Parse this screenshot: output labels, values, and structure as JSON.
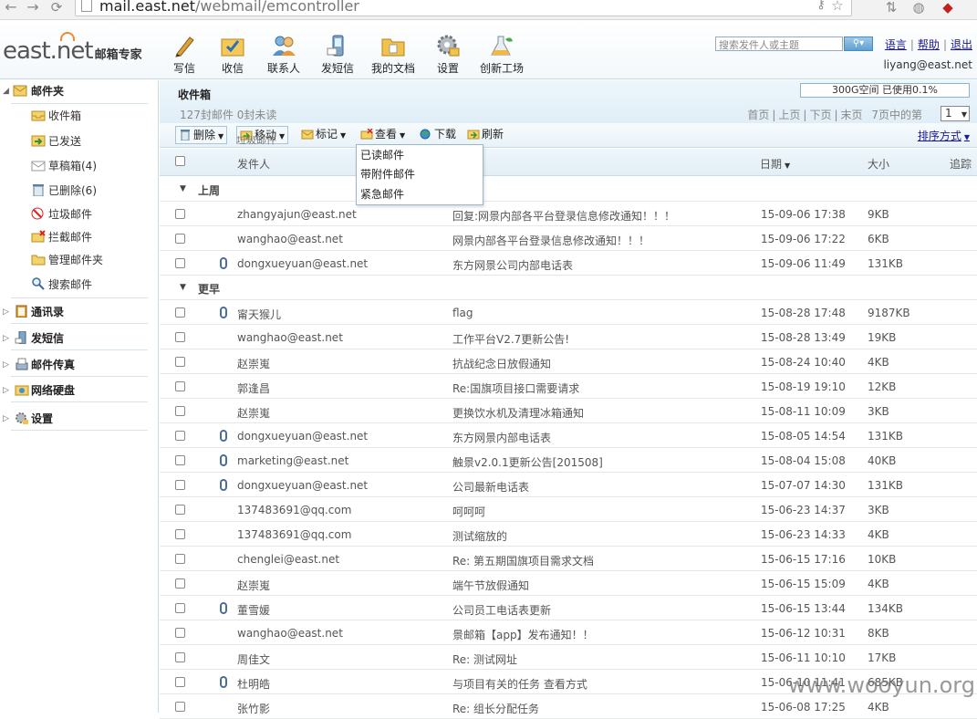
{
  "browser": {
    "url_domain": "mail.east.net",
    "url_path": "/webmail/emcontroller"
  },
  "header": {
    "logo_text": "east.net",
    "logo_sub": "邮箱专家",
    "toolbar": [
      {
        "label": "写信",
        "icon": "pen-icon"
      },
      {
        "label": "收信",
        "icon": "inbox-check-icon"
      },
      {
        "label": "联系人",
        "icon": "contacts-icon"
      },
      {
        "label": "发短信",
        "icon": "phone-sms-icon"
      },
      {
        "label": "我的文档",
        "icon": "folder-icon"
      },
      {
        "label": "设置",
        "icon": "gear-icon"
      },
      {
        "label": "创新工场",
        "icon": "flask-icon"
      }
    ],
    "search_placeholder": "搜索发件人或主题",
    "links": {
      "language": "语言",
      "help": "帮助",
      "logout": "退出"
    },
    "user_email": "liyang@east.net"
  },
  "sidebar": {
    "mail_folders_label": "邮件夹",
    "folders": [
      {
        "label": "收件箱",
        "icon": "inbox-icon"
      },
      {
        "label": "已发送",
        "icon": "sent-icon"
      },
      {
        "label": "草稿箱(4)",
        "icon": "draft-icon"
      },
      {
        "label": "已删除(6)",
        "icon": "trash-icon"
      },
      {
        "label": "垃圾邮件",
        "icon": "spam-icon"
      },
      {
        "label": "拦截邮件",
        "icon": "blocked-icon"
      },
      {
        "label": "管理邮件夹",
        "icon": "manage-folder-icon"
      },
      {
        "label": "搜索邮件",
        "icon": "search-mail-icon"
      }
    ],
    "groups": [
      {
        "label": "通讯录",
        "icon": "address-book-icon"
      },
      {
        "label": "发短信",
        "icon": "sms-icon"
      },
      {
        "label": "邮件传真",
        "icon": "fax-icon"
      },
      {
        "label": "网络硬盘",
        "icon": "disk-icon"
      },
      {
        "label": "设置",
        "icon": "settings-icon"
      }
    ]
  },
  "main": {
    "title": "收件箱",
    "count_text": "127封邮件 0封未读",
    "quota_text": "300G空间 已使用0.1%",
    "pager": [
      "首页",
      "上页",
      "下页",
      "末页",
      "7页中的第"
    ],
    "page_value": "1",
    "toolbar": {
      "delete": "删除",
      "move": "移动",
      "mark": "标记",
      "view": "查看",
      "download": "下载",
      "refresh": "刷新",
      "sort": "排序方式"
    },
    "dropdown_ghost": "垃圾邮件",
    "view_dropdown": [
      "已读邮件",
      "带附件邮件",
      "紧急邮件"
    ],
    "columns": {
      "sender": "发件人",
      "date": "日期",
      "size": "大小",
      "track": "追踪"
    },
    "groups": [
      {
        "label": "上周",
        "rows": [
          {
            "sender": "zhangyajun@east.net",
            "subject": "回复:网景内部各平台登录信息修改通知！！！",
            "date": "15-09-06 17:38",
            "size": "9KB",
            "attach": false
          },
          {
            "sender": "wanghao@east.net",
            "subject": "网景内部各平台登录信息修改通知！！！",
            "date": "15-09-06 17:22",
            "size": "6KB",
            "attach": false
          },
          {
            "sender": "dongxueyuan@east.net",
            "subject": "东方网景公司内部电话表",
            "date": "15-09-06 11:49",
            "size": "131KB",
            "attach": true
          }
        ]
      },
      {
        "label": "更早",
        "rows": [
          {
            "sender": "甯天猴儿",
            "subject": "flag",
            "date": "15-08-28 17:48",
            "size": "9187KB",
            "attach": true
          },
          {
            "sender": "wanghao@east.net",
            "subject": "工作平台V2.7更新公告!",
            "date": "15-08-28 13:49",
            "size": "19KB",
            "attach": false
          },
          {
            "sender": "赵崇嵬",
            "subject": "抗战纪念日放假通知",
            "date": "15-08-24 10:40",
            "size": "4KB",
            "attach": false
          },
          {
            "sender": "郭逢昌",
            "subject": "Re:国旗项目接口需要请求",
            "date": "15-08-19 19:10",
            "size": "12KB",
            "attach": false
          },
          {
            "sender": "赵崇嵬",
            "subject": "更换饮水机及清理冰箱通知",
            "date": "15-08-11 10:09",
            "size": "3KB",
            "attach": false
          },
          {
            "sender": "dongxueyuan@east.net",
            "subject": "东方网景内部电话表",
            "date": "15-08-05 14:54",
            "size": "131KB",
            "attach": true
          },
          {
            "sender": "marketing@east.net",
            "subject": "触景v2.0.1更新公告[201508]",
            "date": "15-08-04 15:08",
            "size": "40KB",
            "attach": true
          },
          {
            "sender": "dongxueyuan@east.net",
            "subject": "公司最新电话表",
            "date": "15-07-07 14:30",
            "size": "131KB",
            "attach": true
          },
          {
            "sender": "137483691@qq.com",
            "subject": "呵呵呵",
            "date": "15-06-23 14:37",
            "size": "3KB",
            "attach": false
          },
          {
            "sender": "137483691@qq.com",
            "subject": "测试缩放的",
            "date": "15-06-23 14:33",
            "size": "4KB",
            "attach": false
          },
          {
            "sender": "chenglei@east.net",
            "subject": "Re: 第五期国旗项目需求文档",
            "date": "15-06-15 17:16",
            "size": "10KB",
            "attach": false
          },
          {
            "sender": "赵崇嵬",
            "subject": "端午节放假通知",
            "date": "15-06-15 15:09",
            "size": "4KB",
            "attach": false
          },
          {
            "sender": "董雪媛",
            "subject": "公司员工电话表更新",
            "date": "15-06-15 13:44",
            "size": "134KB",
            "attach": true
          },
          {
            "sender": "wanghao@east.net",
            "subject": "景邮箱【app】发布通知！！",
            "date": "15-06-12 10:31",
            "size": "8KB",
            "attach": false
          },
          {
            "sender": "周佳文",
            "subject": "Re: 测试网址",
            "date": "15-06-11 10:10",
            "size": "17KB",
            "attach": false
          },
          {
            "sender": "杜明皓",
            "subject": "与项目有关的任务 查看方式",
            "date": "15-06-10 11:41",
            "size": "685KB",
            "attach": true
          },
          {
            "sender": "张竹影",
            "subject": "Re: 组长分配任务",
            "date": "15-06-08 17:25",
            "size": "4KB",
            "attach": false
          }
        ]
      }
    ]
  },
  "watermark": "www.wooyun.org",
  "colors": {
    "accent_blue": "#1a1a99",
    "header_bg": "#e0eef7",
    "clip_blue": "#4b6d9b"
  }
}
